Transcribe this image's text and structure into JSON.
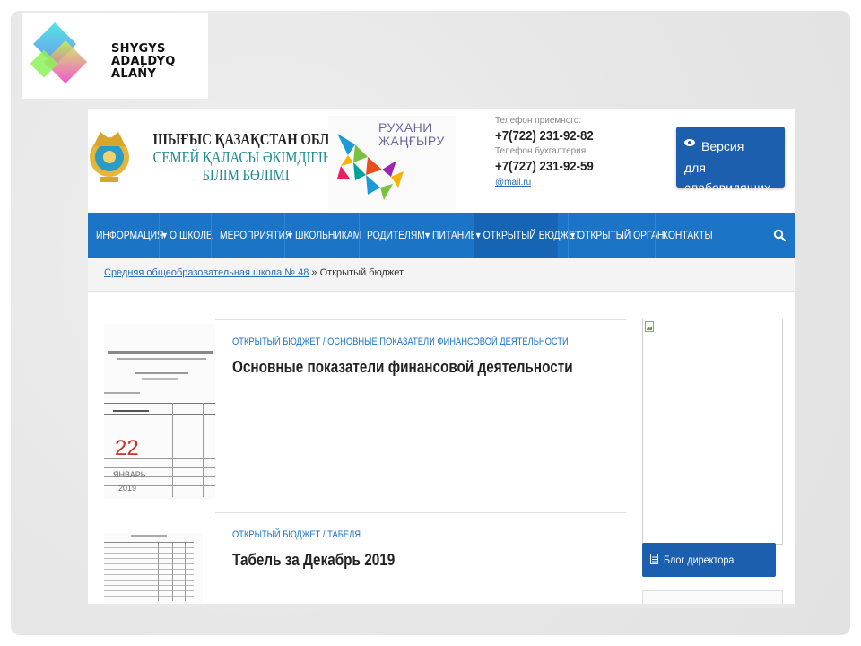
{
  "slide_logo": {
    "line1": "SHYGYS",
    "line2": "ADALDYQ ALAŃY"
  },
  "header": {
    "dept_line1": "ШЫҒЫС ҚАЗАҚСТАН ОБЛЫСЫ",
    "dept_line2": "СЕМЕЙ ҚАЛАСЫ ӘКІМДІГІНІҢ",
    "dept_line3": "БІЛІМ БӨЛІМІ",
    "ruhani_line1": "РУХАНИ",
    "ruhani_line2": "ЖАҢҒЫРУ",
    "reception_label": "Телефон приемного:",
    "reception_phone": "+7(722) 231-92-82",
    "accounting_label": "Телефон бухгалтерия:",
    "accounting_phone": "+7(727) 231-92-59",
    "email": "@mail.ru",
    "vision_line1": "Версия",
    "vision_line2": "для слабовидящих"
  },
  "nav": {
    "items": [
      "ИНФОРМАЦИЯ",
      "▾ О ШКОЛЕ",
      "МЕРОПРИЯТИЯ",
      "▾ ШКОЛЬНИКАМ",
      "РОДИТЕЛЯМ",
      "▾ ПИТАНИЕ",
      "▾ ОТКРЫТЫЙ БЮДЖЕТ",
      "▾ ОТКРЫТЫЙ ОРГАН",
      "КОНТАКТЫ"
    ],
    "search_icon": "search-icon"
  },
  "breadcrumb": {
    "home": "Средняя общеобразовательная школа № 48",
    "sep": " » ",
    "current": "Открытый бюджет"
  },
  "posts": [
    {
      "category": "ОТКРЫТЫЙ БЮДЖЕТ / ОСНОВНЫЕ ПОКАЗАТЕЛИ ФИНАНСОВОЙ ДЕЯТЕЛЬНОСТИ",
      "title": "Основные показатели финансовой деятельности",
      "date_day": "22",
      "date_month": "ЯНВАРЬ",
      "date_year": "2019"
    },
    {
      "category": "ОТКРЫТЫЙ БЮДЖЕТ / ТАБЕЛЯ",
      "title": "Табель за Декабрь 2019"
    }
  ],
  "sidebar": {
    "blog_label": "Блог директора"
  },
  "colors": {
    "nav_blue": "#1c74c7",
    "button_blue": "#1b5fae",
    "date_red": "#c8322d",
    "dept_teal": "#1a8a8f"
  }
}
